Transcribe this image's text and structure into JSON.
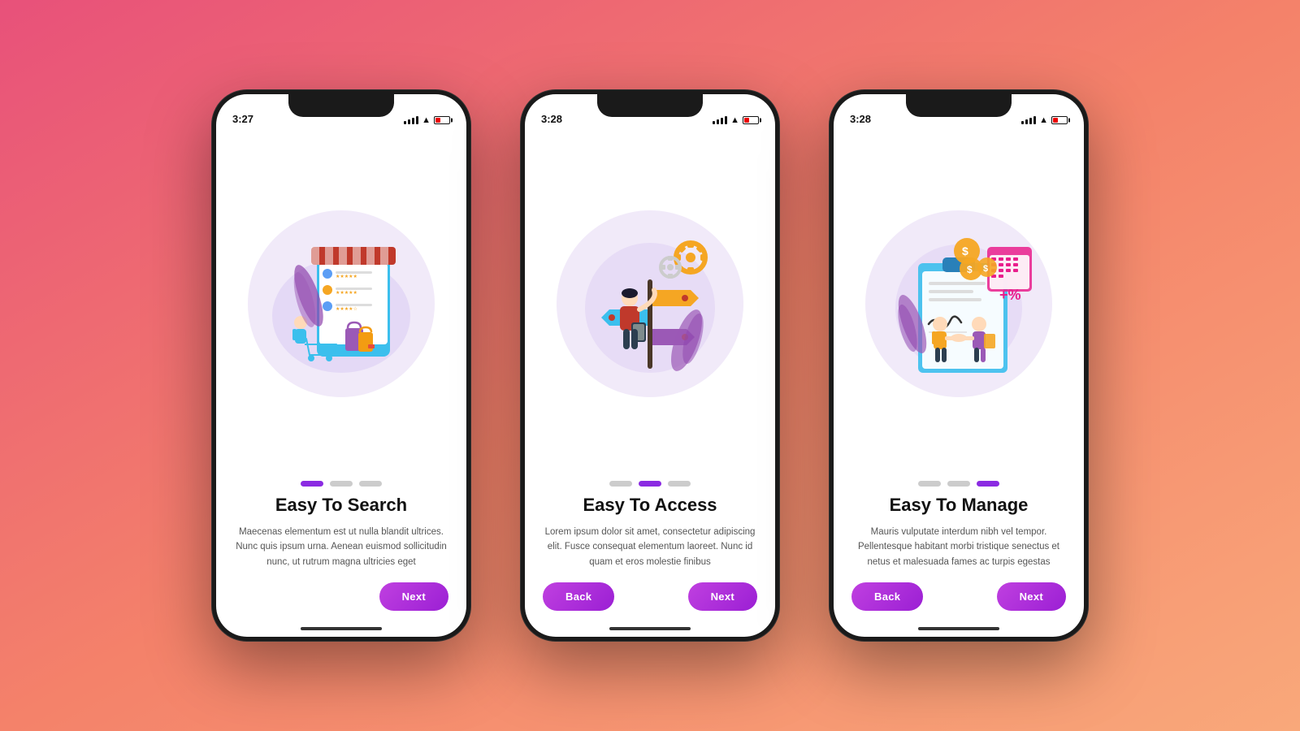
{
  "background": "#f4826a",
  "phones": [
    {
      "id": "phone-1",
      "time": "3:27",
      "title": "Easy To Search",
      "description": "Maecenas elementum est ut nulla blandit ultrices. Nunc quis ipsum urna. Aenean euismod sollicitudin nunc, ut rutrum magna ultricies eget",
      "dots": [
        "active",
        "inactive",
        "inactive"
      ],
      "buttons": [
        {
          "label": "Next",
          "type": "next"
        }
      ],
      "illustration": "shopping"
    },
    {
      "id": "phone-2",
      "time": "3:28",
      "title": "Easy To Access",
      "description": "Lorem ipsum dolor sit amet, consectetur adipiscing elit. Fusce consequat elementum laoreet. Nunc id quam et eros molestie finibus",
      "dots": [
        "inactive",
        "active",
        "inactive"
      ],
      "buttons": [
        {
          "label": "Back",
          "type": "back"
        },
        {
          "label": "Next",
          "type": "next"
        }
      ],
      "illustration": "access"
    },
    {
      "id": "phone-3",
      "time": "3:28",
      "title": "Easy To Manage",
      "description": "Mauris vulputate interdum nibh vel tempor. Pellentesque habitant morbi tristique senectus et netus et malesuada fames ac turpis egestas",
      "dots": [
        "inactive",
        "inactive",
        "active"
      ],
      "buttons": [
        {
          "label": "Back",
          "type": "back"
        },
        {
          "label": "Next",
          "type": "next"
        }
      ],
      "illustration": "manage"
    }
  ]
}
